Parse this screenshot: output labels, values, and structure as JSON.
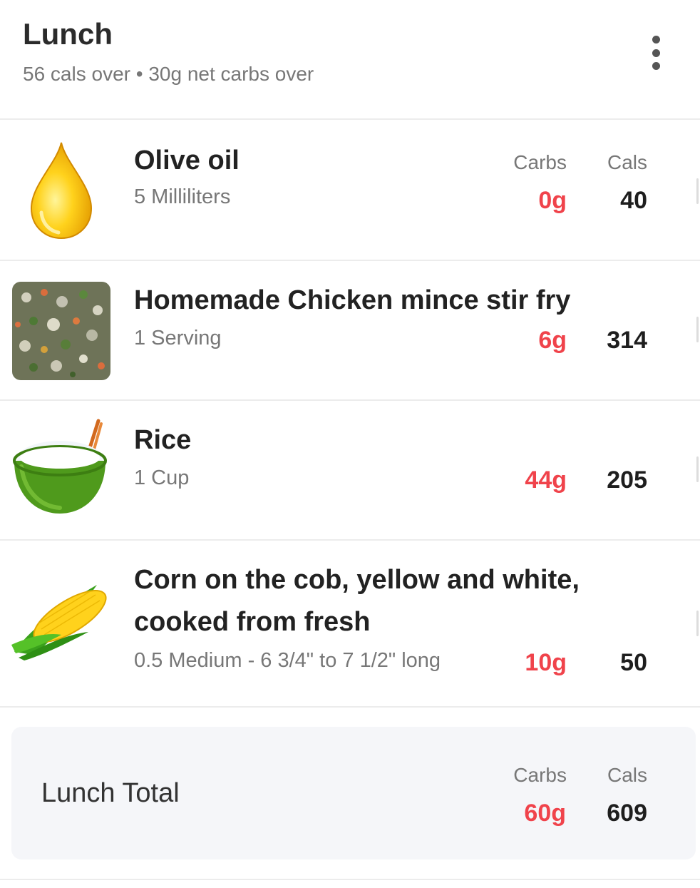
{
  "meal": {
    "title": "Lunch",
    "summary": "56 cals over • 30g net carbs over"
  },
  "columns": {
    "carbs": "Carbs",
    "cals": "Cals"
  },
  "items": [
    {
      "name": "Olive oil",
      "serving": "5 Milliliters",
      "carbs": "0g",
      "cals": "40",
      "icon": "olive-oil-drop-icon"
    },
    {
      "name": "Homemade Chicken mince stir fry",
      "serving": "1 Serving",
      "carbs": "6g",
      "cals": "314",
      "icon": "stir-fry-photo"
    },
    {
      "name": "Rice",
      "serving": "1 Cup",
      "carbs": "44g",
      "cals": "205",
      "icon": "rice-bowl-icon"
    },
    {
      "name_line1": "Corn on the cob, yellow and white,",
      "name_line2": "cooked from fresh",
      "serving": "0.5 Medium - 6 3/4\" to 7 1/2\" long",
      "carbs": "10g",
      "cals": "50",
      "icon": "corn-cob-icon"
    }
  ],
  "total": {
    "label": "Lunch Total",
    "carbs": "60g",
    "cals": "609"
  },
  "colors": {
    "carbs": "#f0434b",
    "text": "#222222",
    "muted": "#777777",
    "total_bg": "#f5f6f9"
  }
}
